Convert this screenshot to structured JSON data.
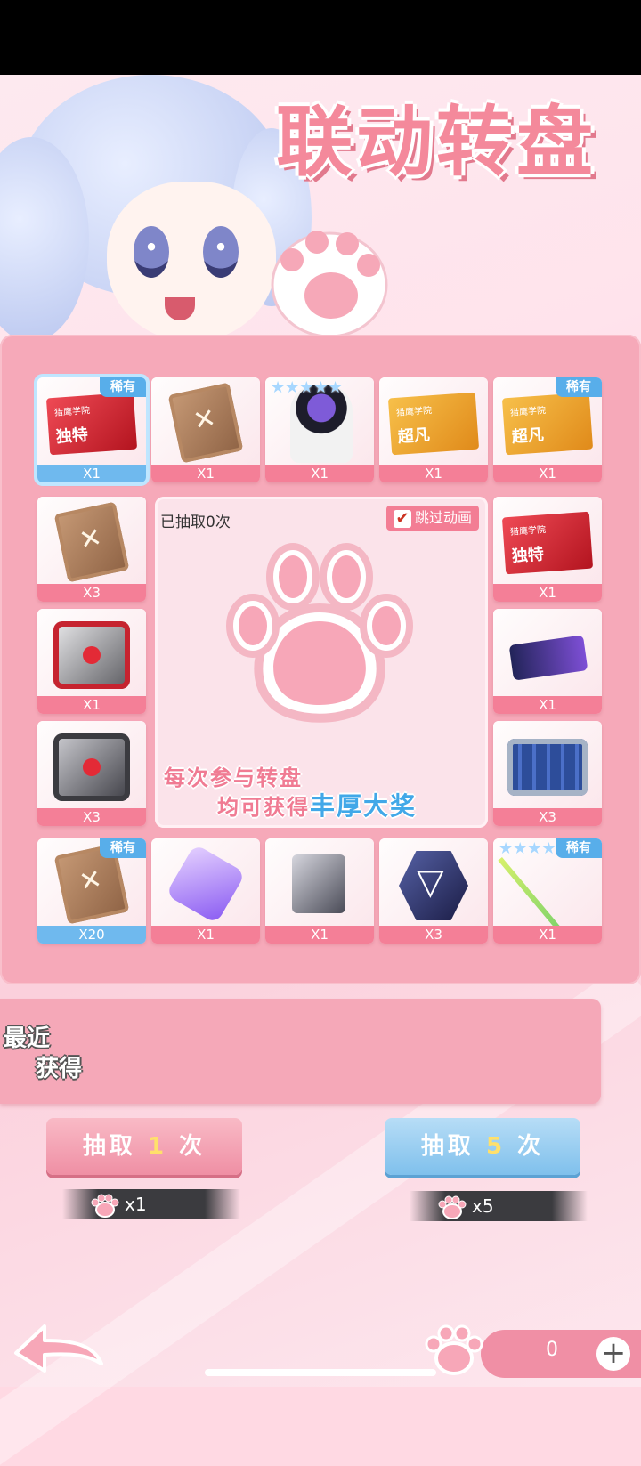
{
  "title": "联动转盘",
  "board": {
    "drawn_label": "已抽取0次",
    "skip_animation": "跳过动画",
    "promo_line1": "每次参与转盘",
    "promo_line2_prefix": "均可获得",
    "promo_line2_highlight": "丰厚大奖",
    "items": [
      {
        "qty": "X1",
        "badge": "稀有",
        "art": "ticket-red",
        "ticket_text": "独特",
        "ticket_sub": "猎鹰学院"
      },
      {
        "qty": "X1",
        "badge": "",
        "art": "crate"
      },
      {
        "qty": "X1",
        "badge": "",
        "art": "robot",
        "stars": "★★★★★"
      },
      {
        "qty": "X1",
        "badge": "",
        "art": "ticket-gold",
        "ticket_text": "超凡",
        "ticket_sub": "猎鹰学院"
      },
      {
        "qty": "X1",
        "badge": "稀有",
        "art": "ticket-gold",
        "ticket_text": "超凡",
        "ticket_sub": "猎鹰学院"
      },
      {
        "qty": "X3",
        "badge": "",
        "art": "crate"
      },
      {
        "qty": "X1",
        "badge": "",
        "art": "ticket-red",
        "ticket_text": "独特",
        "ticket_sub": "猎鹰学院"
      },
      {
        "qty": "X1",
        "badge": "",
        "art": "box-red"
      },
      {
        "qty": "X1",
        "badge": "",
        "art": "card"
      },
      {
        "qty": "X3",
        "badge": "",
        "art": "box-gray"
      },
      {
        "qty": "X3",
        "badge": "",
        "art": "case"
      },
      {
        "qty": "X20",
        "badge": "稀有",
        "art": "crate"
      },
      {
        "qty": "X1",
        "badge": "",
        "art": "gem"
      },
      {
        "qty": "X1",
        "badge": "",
        "art": "chip"
      },
      {
        "qty": "X3",
        "badge": "",
        "art": "triangle"
      },
      {
        "qty": "X1",
        "badge": "稀有",
        "art": "rod",
        "stars": "★★★★★"
      }
    ]
  },
  "recent": {
    "label_line1": "最近",
    "label_line2": "获得"
  },
  "draw1": {
    "prefix": "抽取",
    "count": "1",
    "suffix": "次",
    "cost": "x1"
  },
  "draw5": {
    "prefix": "抽取",
    "count": "5",
    "suffix": "次",
    "cost": "x5"
  },
  "counter": {
    "value": "0",
    "plus": "+"
  },
  "colors": {
    "accent_pink": "#f47f97",
    "accent_blue": "#6fb9ee",
    "rare_badge": "#58aeea"
  }
}
